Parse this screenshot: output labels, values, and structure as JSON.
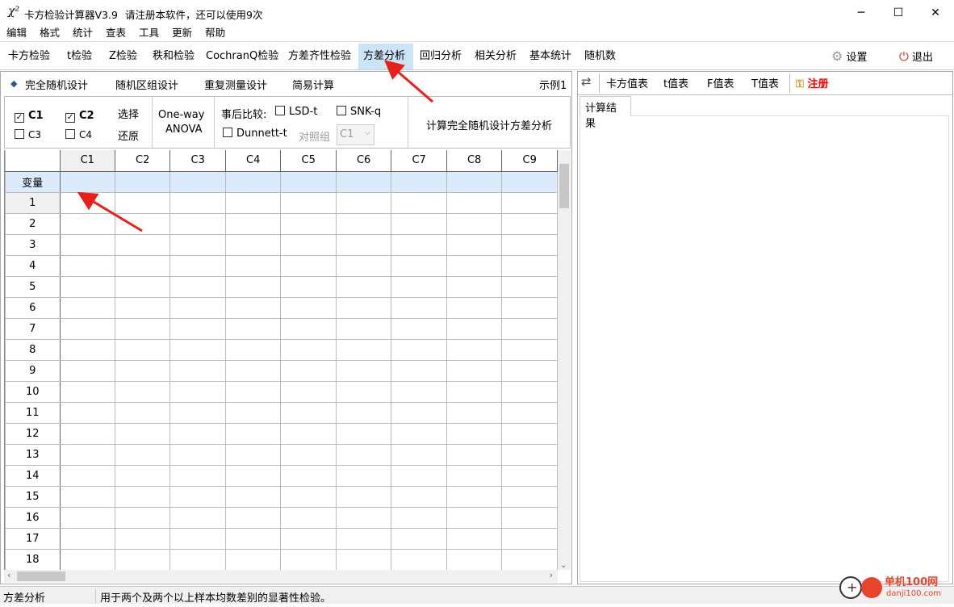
{
  "window": {
    "title": "卡方检验计算器V3.9",
    "notice": "请注册本软件，还可以使用9次",
    "icon": "chi-square-icon",
    "minimize": "─",
    "maximize": "☐",
    "close": "✕"
  },
  "menu": [
    "编辑",
    "格式",
    "统计",
    "查表",
    "工具",
    "更新",
    "帮助"
  ],
  "toolbar": {
    "tabs": [
      "卡方检验",
      "t检验",
      "Z检验",
      "秩和检验",
      "CochranQ检验",
      "方差齐性检验",
      "方差分析",
      "回归分析",
      "相关分析",
      "基本统计",
      "随机数"
    ],
    "active": "方差分析",
    "settings": "设置",
    "exit": "退出"
  },
  "design_tabs": {
    "items": [
      "完全随机设计",
      "随机区组设计",
      "重复测量设计",
      "简易计算"
    ],
    "active": "完全随机设计",
    "example": "示例1"
  },
  "options": {
    "columns": [
      {
        "label": "C1",
        "checked": true
      },
      {
        "label": "C2",
        "checked": true
      },
      {
        "label": "C3",
        "checked": false
      },
      {
        "label": "C4",
        "checked": false
      }
    ],
    "select": "选择",
    "restore": "还原",
    "method_line1": "One-way",
    "method_line2": "ANOVA",
    "posthoc_label": "事后比较:",
    "lsd": "LSD-t",
    "snk": "SNK-q",
    "dunnett": "Dunnett-t",
    "control_group_label": "对照组",
    "control_group_value": "C1",
    "compute": "计算完全随机设计方差分析"
  },
  "grid": {
    "columns": [
      "C1",
      "C2",
      "C3",
      "C4",
      "C5",
      "C6",
      "C7",
      "C8",
      "C9"
    ],
    "variable_row": "变量",
    "rows": [
      "1",
      "2",
      "3",
      "4",
      "5",
      "6",
      "7",
      "8",
      "9",
      "10",
      "11",
      "12",
      "13",
      "14",
      "15",
      "16",
      "17",
      "18"
    ]
  },
  "right": {
    "swap": "⇄",
    "tables": [
      "卡方值表",
      "t值表",
      "F值表",
      "T值表"
    ],
    "register": "注册",
    "result_tab": "计算结果"
  },
  "status": {
    "left": "方差分析",
    "right": "用于两个及两个以上样本均数差别的显著性检验。"
  },
  "watermark": {
    "name": "单机100网",
    "url": "danji100.com"
  },
  "colors": {
    "accent": "#cce4f7",
    "selection": "#ff0000",
    "register": "#ff0000",
    "variable_row": "#dcebfb"
  }
}
